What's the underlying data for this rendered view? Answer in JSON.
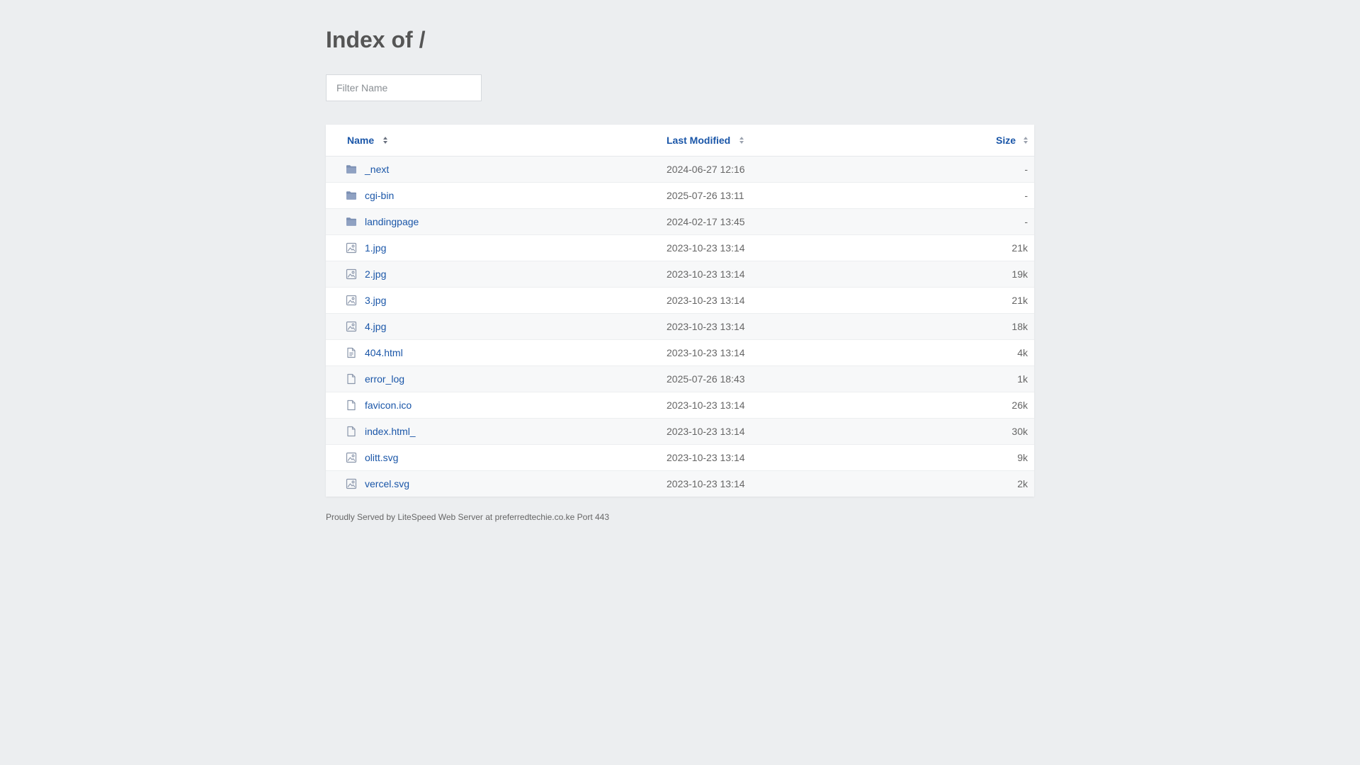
{
  "page": {
    "title": "Index of /"
  },
  "filter": {
    "placeholder": "Filter Name"
  },
  "table": {
    "columns": {
      "name": "Name",
      "modified": "Last Modified",
      "size": "Size"
    },
    "rows": [
      {
        "name": "_next",
        "modified": "2024-06-27 12:16",
        "size": "-",
        "icon": "folder-icon"
      },
      {
        "name": "cgi-bin",
        "modified": "2025-07-26 13:11",
        "size": "-",
        "icon": "folder-icon"
      },
      {
        "name": "landingpage",
        "modified": "2024-02-17 13:45",
        "size": "-",
        "icon": "folder-icon"
      },
      {
        "name": "1.jpg",
        "modified": "2023-10-23 13:14",
        "size": "21k",
        "icon": "image-icon"
      },
      {
        "name": "2.jpg",
        "modified": "2023-10-23 13:14",
        "size": "19k",
        "icon": "image-icon"
      },
      {
        "name": "3.jpg",
        "modified": "2023-10-23 13:14",
        "size": "21k",
        "icon": "image-icon"
      },
      {
        "name": "4.jpg",
        "modified": "2023-10-23 13:14",
        "size": "18k",
        "icon": "image-icon"
      },
      {
        "name": "404.html",
        "modified": "2023-10-23 13:14",
        "size": "4k",
        "icon": "text-file-icon"
      },
      {
        "name": "error_log",
        "modified": "2025-07-26 18:43",
        "size": "1k",
        "icon": "file-icon"
      },
      {
        "name": "favicon.ico",
        "modified": "2023-10-23 13:14",
        "size": "26k",
        "icon": "file-icon"
      },
      {
        "name": "index.html_",
        "modified": "2023-10-23 13:14",
        "size": "30k",
        "icon": "file-icon"
      },
      {
        "name": "olitt.svg",
        "modified": "2023-10-23 13:14",
        "size": "9k",
        "icon": "image-icon"
      },
      {
        "name": "vercel.svg",
        "modified": "2023-10-23 13:14",
        "size": "2k",
        "icon": "image-icon"
      }
    ]
  },
  "footer": {
    "text": "Proudly Served by LiteSpeed Web Server at preferredtechie.co.ke Port 443"
  },
  "colors": {
    "background": "#eceef0",
    "link": "#1a56a8",
    "folder": "#7b8fb3",
    "icon_outline": "#8a96ab"
  }
}
